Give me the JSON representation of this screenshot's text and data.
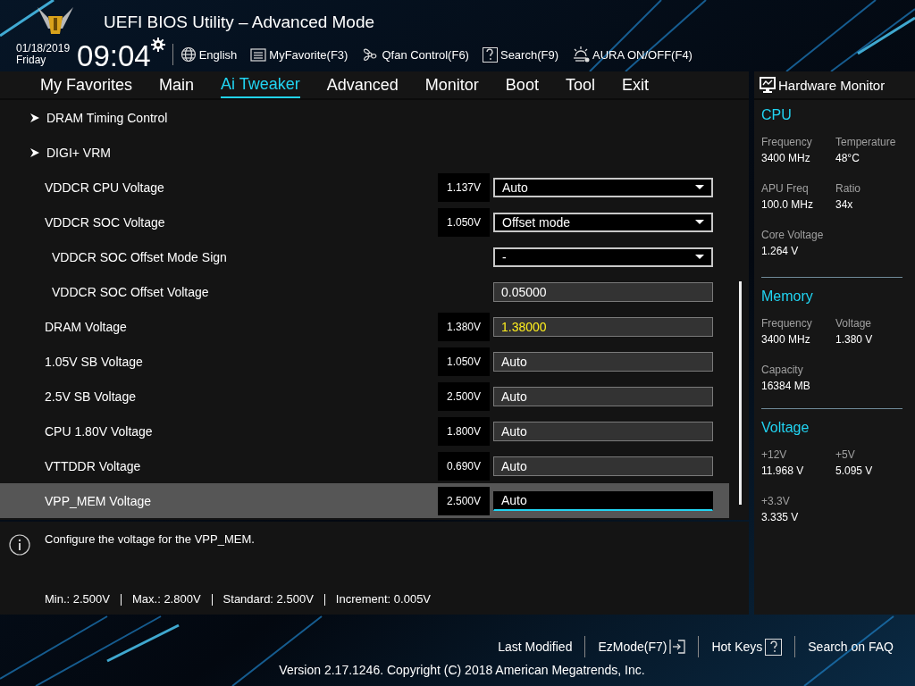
{
  "window": {
    "title": "UEFI BIOS Utility – Advanced Mode"
  },
  "clock": {
    "date": "01/18/2019",
    "day": "Friday",
    "time": "09:04"
  },
  "toolbar": [
    {
      "label": "English",
      "kind": "globe"
    },
    {
      "label": "MyFavorite(F3)",
      "kind": "list"
    },
    {
      "label": "Qfan Control(F6)",
      "kind": "fan"
    },
    {
      "label": "Search(F9)",
      "kind": "question"
    },
    {
      "label": "AURA ON/OFF(F4)",
      "kind": "aura"
    }
  ],
  "tabs": [
    {
      "label": "My Favorites",
      "selected": false
    },
    {
      "label": "Main",
      "selected": false
    },
    {
      "label": "Ai Tweaker",
      "selected": true
    },
    {
      "label": "Advanced",
      "selected": false
    },
    {
      "label": "Monitor",
      "selected": false
    },
    {
      "label": "Boot",
      "selected": false
    },
    {
      "label": "Tool",
      "selected": false
    },
    {
      "label": "Exit",
      "selected": false
    }
  ],
  "settings": [
    {
      "kind": "submenu",
      "label": "DRAM Timing Control",
      "selected": false
    },
    {
      "kind": "submenu",
      "label": "DIGI+ VRM",
      "selected": false
    },
    {
      "kind": "setting",
      "label": "VDDCR CPU Voltage",
      "reading": "1.137V",
      "control": {
        "kind": "dropdown",
        "value": "Auto",
        "modified": false
      },
      "selected": false
    },
    {
      "kind": "setting",
      "label": "VDDCR SOC Voltage",
      "reading": "1.050V",
      "control": {
        "kind": "dropdown",
        "value": "Offset mode",
        "modified": false
      },
      "selected": false,
      "children": [
        {
          "kind": "setting",
          "label": "VDDCR SOC Offset Mode Sign",
          "control": {
            "kind": "dropdown",
            "value": "-",
            "modified": false
          },
          "selected": false
        },
        {
          "kind": "setting",
          "label": "VDDCR SOC Offset Voltage",
          "control": {
            "kind": "field",
            "value": "0.05000",
            "modified": false
          },
          "selected": false
        }
      ]
    },
    {
      "kind": "setting",
      "label": "DRAM Voltage",
      "reading": "1.380V",
      "control": {
        "kind": "field",
        "value": "1.38000",
        "modified": true
      },
      "selected": false
    },
    {
      "kind": "setting",
      "label": "1.05V SB Voltage",
      "reading": "1.050V",
      "control": {
        "kind": "field",
        "value": "Auto",
        "modified": false
      },
      "selected": false
    },
    {
      "kind": "setting",
      "label": "2.5V SB Voltage",
      "reading": "2.500V",
      "control": {
        "kind": "field",
        "value": "Auto",
        "modified": false
      },
      "selected": false
    },
    {
      "kind": "setting",
      "label": "CPU 1.80V Voltage",
      "reading": "1.800V",
      "control": {
        "kind": "field",
        "value": "Auto",
        "modified": false
      },
      "selected": false
    },
    {
      "kind": "setting",
      "label": "VTTDDR Voltage",
      "reading": "0.690V",
      "control": {
        "kind": "field",
        "value": "Auto",
        "modified": false
      },
      "selected": false
    },
    {
      "kind": "setting",
      "label": "VPP_MEM Voltage",
      "reading": "2.500V",
      "control": {
        "kind": "field",
        "value": "Auto",
        "modified": false
      },
      "selected": true
    }
  ],
  "help": {
    "text": "Configure the voltage for the VPP_MEM.",
    "limits": [
      "Min.: 2.500V",
      "Max.: 2.800V",
      "Standard: 2.500V",
      "Increment: 0.005V"
    ]
  },
  "hardware_monitor": {
    "title": "Hardware Monitor",
    "sections": [
      {
        "title": "CPU",
        "items": [
          {
            "label": "Frequency",
            "value": "3400 MHz"
          },
          {
            "label": "Temperature",
            "value": "48°C"
          },
          {
            "label": "APU Freq",
            "value": "100.0 MHz"
          },
          {
            "label": "Ratio",
            "value": "34x"
          },
          {
            "label": "Core Voltage",
            "value": "1.264 V"
          }
        ]
      },
      {
        "title": "Memory",
        "items": [
          {
            "label": "Frequency",
            "value": "3400 MHz"
          },
          {
            "label": "Voltage",
            "value": "1.380 V"
          },
          {
            "label": "Capacity",
            "value": "16384 MB"
          }
        ]
      },
      {
        "title": "Voltage",
        "items": [
          {
            "label": "+12V",
            "value": "11.968 V"
          },
          {
            "label": "+5V",
            "value": "5.095 V"
          },
          {
            "label": "+3.3V",
            "value": "3.335 V"
          }
        ]
      }
    ]
  },
  "footer": {
    "links": [
      {
        "label": "Last Modified",
        "kind": "plain"
      },
      {
        "label": "EzMode(F7)",
        "kind": "exit"
      },
      {
        "label": "Hot Keys",
        "kind": "help"
      },
      {
        "label": "Search on FAQ",
        "kind": "plain"
      }
    ],
    "version": "Version 2.17.1246. Copyright (C) 2018 American Megatrends, Inc."
  }
}
